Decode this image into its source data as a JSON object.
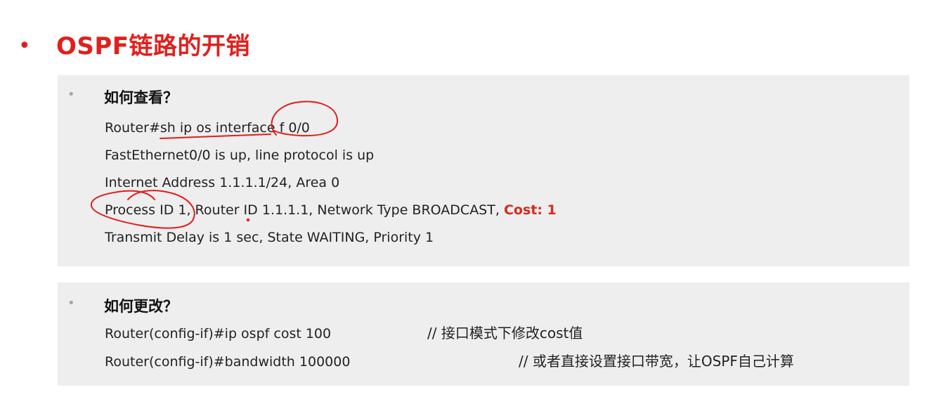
{
  "title": {
    "bullet": "•",
    "text": "OSPF链路的开销"
  },
  "view_section": {
    "bullet": "•",
    "heading": "如何查看？",
    "lines": [
      "Router#sh ip os interface f 0/0",
      "FastEthernet0/0 is up, line protocol is up",
      "Internet Address 1.1.1.1/24, Area 0",
      "Process ID 1, Router ID 1.1.1.1, Network Type BROADCAST, ",
      "Transmit Delay is 1 sec, State WAITING, Priority 1"
    ],
    "cost_highlight": "Cost: 1"
  },
  "change_section": {
    "bullet": "•",
    "heading": "如何更改？",
    "commands": [
      {
        "command": "Router(config-if)#ip ospf cost 100",
        "comment": "// 接口模式下修改cost值"
      },
      {
        "command": "Router(config-if)#bandwidth 100000",
        "comment": "// 或者直接设置接口带宽，让OSPF自己计算"
      }
    ]
  },
  "colors": {
    "title_red": "#e0201c",
    "cost_red": "#d62a1e",
    "annotation_red": "#e31b1b",
    "panel_gray": "#eeeeee"
  }
}
